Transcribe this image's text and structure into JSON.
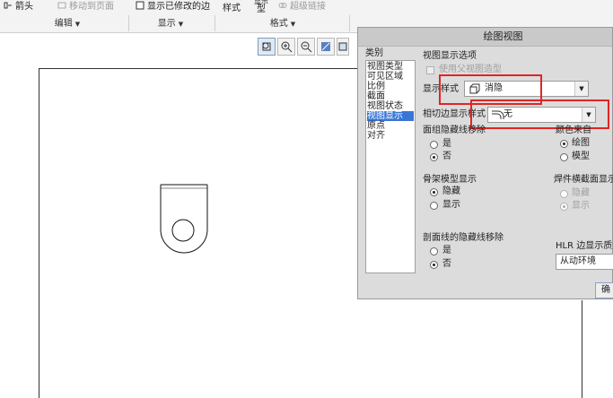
{
  "ribbon": {
    "row1": {
      "arrow": "箭头",
      "move_to_page": "移动到页面",
      "show_modified_edges": "显示已修改的边",
      "style": "样式",
      "model_top": "显示",
      "model_bottom": "型",
      "hyperlink": "超级链接"
    },
    "groups": {
      "edit": "编辑",
      "display": "显示",
      "format": "格式"
    }
  },
  "toolbar": {
    "icons": [
      "zoom-fit-icon",
      "zoom-in-icon",
      "zoom-out-icon",
      "repaint-icon",
      "display-style-icon"
    ]
  },
  "dialog": {
    "title": "绘图视图",
    "category_label": "类别",
    "categories": [
      "视图类型",
      "可见区域",
      "比例",
      "截面",
      "视图状态",
      "视图显示",
      "原点",
      "对齐"
    ],
    "selected_category": "视图显示",
    "section_title": "视图显示选项",
    "use_parent_style": "使用父视图造型",
    "display_style_label": "显示样式",
    "display_style_value": "消隐",
    "tangent_style_label": "相切边显示样式",
    "tangent_style_value": "无",
    "face_hidden_label": "面组隐藏线移除",
    "yes": "是",
    "no": "否",
    "color_from_label": "颜色来自",
    "color_drawing": "绘图",
    "color_model": "模型",
    "skeleton_label": "骨架模型显示",
    "hidden": "隐藏",
    "show": "显示",
    "weld_label": "焊件横截面显示",
    "section_hidden_label": "剖面线的隐藏线移除",
    "hlr_label": "HLR 边显示质量",
    "hlr_value": "从动环境",
    "ok_button": "确"
  },
  "colors": {
    "highlight": "#e02525",
    "selection": "#3875d7"
  }
}
